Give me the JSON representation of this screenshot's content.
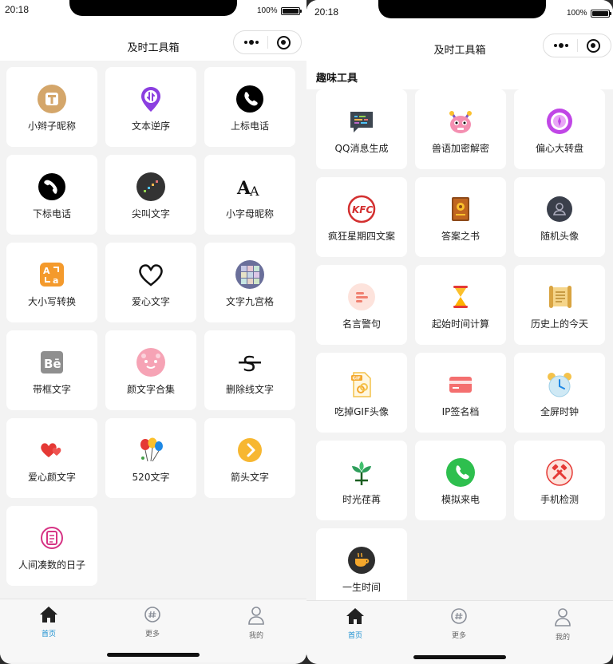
{
  "status": {
    "time": "20:18",
    "battery_percent": "100%",
    "battery_level": 1.0
  },
  "nav": {
    "title": "及时工具箱"
  },
  "left_tools": [
    {
      "label": "小辫子昵称",
      "icon": "T-badge-icon"
    },
    {
      "label": "文本逆序",
      "icon": "reverse-pin-icon"
    },
    {
      "label": "上标电话",
      "icon": "phone-up-icon"
    },
    {
      "label": "下标电话",
      "icon": "phone-down-icon"
    },
    {
      "label": "尖叫文字",
      "icon": "shout-text-icon"
    },
    {
      "label": "小字母昵称",
      "icon": "small-letters-icon"
    },
    {
      "label": "大小写转换",
      "icon": "case-convert-icon"
    },
    {
      "label": "爱心文字",
      "icon": "heart-outline-icon"
    },
    {
      "label": "文字九宫格",
      "icon": "nine-grid-icon"
    },
    {
      "label": "带框文字",
      "icon": "boxed-text-icon"
    },
    {
      "label": "颜文字合集",
      "icon": "kaomoji-icon"
    },
    {
      "label": "删除线文字",
      "icon": "strikethrough-icon"
    },
    {
      "label": "爱心颜文字",
      "icon": "hearts-icon"
    },
    {
      "label": "520文字",
      "icon": "balloons-icon"
    },
    {
      "label": "箭头文字",
      "icon": "arrow-circle-icon"
    },
    {
      "label": "人间凑数的日子",
      "icon": "calendar-note-icon"
    }
  ],
  "right_section_title": "趣味工具",
  "right_tools": [
    {
      "label": "QQ消息生成",
      "icon": "chat-bubble-icon"
    },
    {
      "label": "兽语加密解密",
      "icon": "beast-face-icon"
    },
    {
      "label": "偏心大转盘",
      "icon": "wheel-icon"
    },
    {
      "label": "疯狂星期四文案",
      "icon": "kfc-icon"
    },
    {
      "label": "答案之书",
      "icon": "book-icon"
    },
    {
      "label": "随机头像",
      "icon": "avatar-icon"
    },
    {
      "label": "名言警句",
      "icon": "quote-lines-icon"
    },
    {
      "label": "起始时间计算",
      "icon": "hourglass-icon"
    },
    {
      "label": "历史上的今天",
      "icon": "scroll-icon"
    },
    {
      "label": "吃掉GIF头像",
      "icon": "gif-file-icon"
    },
    {
      "label": "IP签名档",
      "icon": "card-icon"
    },
    {
      "label": "全屏时钟",
      "icon": "alarm-clock-icon"
    },
    {
      "label": "时光荏苒",
      "icon": "sprout-icon"
    },
    {
      "label": "模拟来电",
      "icon": "incoming-call-icon"
    },
    {
      "label": "手机检测",
      "icon": "tools-icon"
    },
    {
      "label": "一生时间",
      "icon": "coffee-cup-icon"
    }
  ],
  "tabbar": [
    {
      "label": "首页",
      "icon": "home-icon",
      "active": true
    },
    {
      "label": "更多",
      "icon": "more-icon",
      "active": false
    },
    {
      "label": "我的",
      "icon": "profile-icon",
      "active": false
    }
  ],
  "colors": {
    "accent": "#1a8fd0",
    "background": "#f3f3f3",
    "card": "#ffffff"
  }
}
